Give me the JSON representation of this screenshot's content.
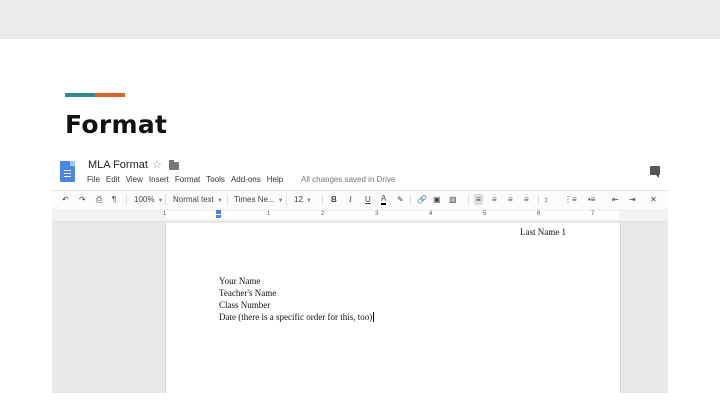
{
  "slide": {
    "title": "Format",
    "accent_colors": [
      "#2a8a8c",
      "#e0621f"
    ]
  },
  "docs": {
    "doc_title": "MLA Format",
    "menu": [
      "File",
      "Edit",
      "View",
      "Insert",
      "Format",
      "Tools",
      "Add-ons",
      "Help"
    ],
    "save_status": "All changes saved in Drive",
    "toolbar": {
      "zoom": "100%",
      "style": "Normal text",
      "font": "Times Ne...",
      "font_size": "12"
    },
    "ruler_numbers": [
      "1",
      "1",
      "2",
      "3",
      "4",
      "5",
      "6",
      "7"
    ],
    "page": {
      "header": "Last Name 1",
      "lines": [
        "Your Name",
        "Teacher's Name",
        "Class Number",
        "Date (there is a specific order for this, too)"
      ]
    }
  }
}
